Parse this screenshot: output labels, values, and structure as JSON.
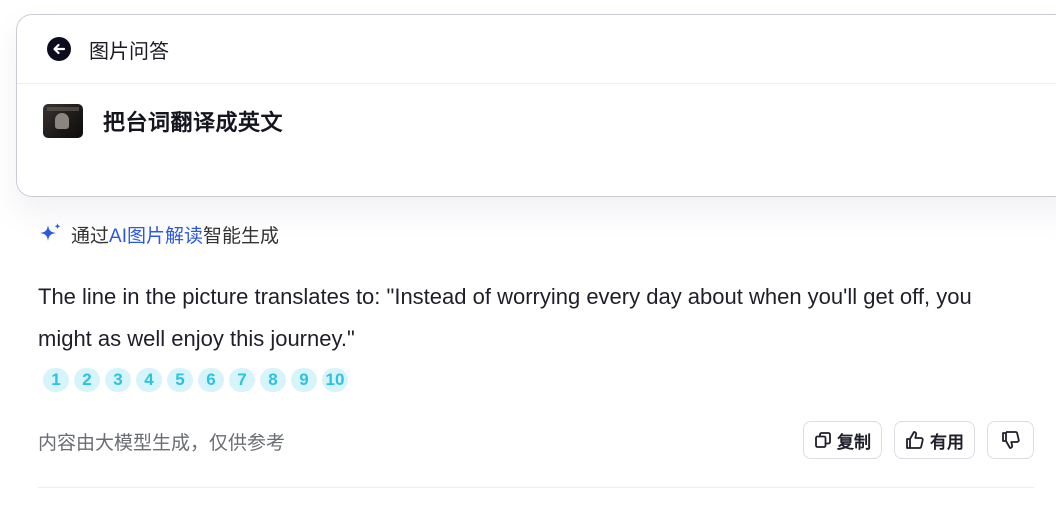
{
  "header": {
    "title": "图片问答",
    "back_icon": "back-arrow-icon"
  },
  "question": {
    "thumbnail_icon": "image-thumbnail",
    "text": "把台词翻译成英文"
  },
  "ai_note": {
    "prefix": "通过",
    "link": "AI图片解读",
    "suffix": "智能生成",
    "icon": "sparkle-icon",
    "link_color": "#2b59e6"
  },
  "answer": {
    "text": "The line in the picture translates to: \"Instead of worrying every day about when you'll get off, you might as well enjoy this journey.\""
  },
  "references": [
    "1",
    "2",
    "3",
    "4",
    "5",
    "6",
    "7",
    "8",
    "9",
    "10"
  ],
  "footer": {
    "disclaimer": "内容由大模型生成，仅供参考",
    "copy_label": "复制",
    "helpful_label": "有用"
  }
}
